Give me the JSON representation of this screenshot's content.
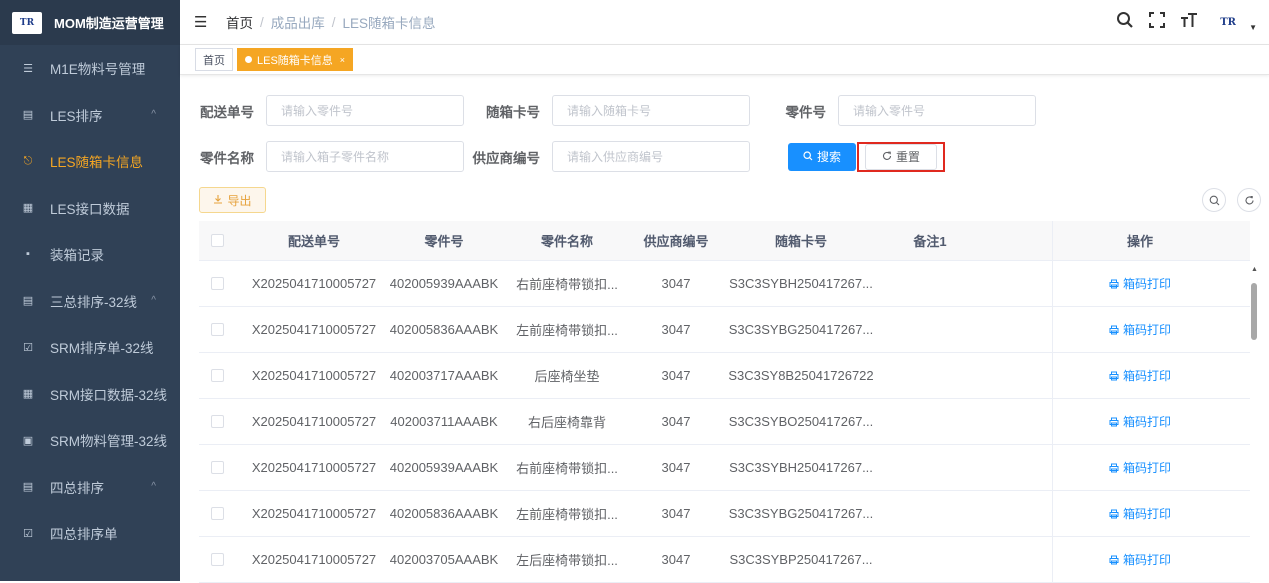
{
  "app": {
    "logo_text": "TR",
    "title": "MOM制造运营管理"
  },
  "sidebar": {
    "items": [
      {
        "label": "M1E物料号管理",
        "icon": "☰",
        "caret": ""
      },
      {
        "label": "LES排序",
        "icon": "▤",
        "caret": "^"
      },
      {
        "label": "LES随箱卡信息",
        "icon": "⎋",
        "caret": ""
      },
      {
        "label": "LES接口数据",
        "icon": "▦",
        "caret": ""
      },
      {
        "label": "装箱记录",
        "icon": "▪",
        "caret": ""
      },
      {
        "label": "三总排序-32线",
        "icon": "▤",
        "caret": "^"
      },
      {
        "label": "SRM排序单-32线",
        "icon": "☑",
        "caret": ""
      },
      {
        "label": "SRM接口数据-32线",
        "icon": "▦",
        "caret": ""
      },
      {
        "label": "SRM物料管理-32线",
        "icon": "▣",
        "caret": ""
      },
      {
        "label": "四总排序",
        "icon": "▤",
        "caret": "^"
      },
      {
        "label": "四总排序单",
        "icon": "☑",
        "caret": ""
      }
    ],
    "active_index": 2
  },
  "breadcrumb": {
    "home": "首页",
    "sep": "/",
    "level1": "成品出库",
    "level2": "LES随箱卡信息"
  },
  "topbar": {
    "search_icon": "⌕",
    "fullscreen_icon": "⛶",
    "size_icon": "тT",
    "avatar": "TR"
  },
  "tags": {
    "home": "首页",
    "active": "LES随箱卡信息",
    "close": "×"
  },
  "form": {
    "delivery_no": {
      "label": "配送单号",
      "placeholder": "请输入零件号"
    },
    "card_no": {
      "label": "随箱卡号",
      "placeholder": "请输入随箱卡号"
    },
    "part_no": {
      "label": "零件号",
      "placeholder": "请输入零件号"
    },
    "part_name": {
      "label": "零件名称",
      "placeholder": "请输入箱子零件名称"
    },
    "supplier_no": {
      "label": "供应商编号",
      "placeholder": "请输入供应商编号"
    },
    "search_label": "搜索",
    "reset_label": "重置"
  },
  "toolbar": {
    "export_label": "导出"
  },
  "table": {
    "columns": [
      "配送单号",
      "零件号",
      "零件名称",
      "供应商编号",
      "随箱卡号",
      "备注1",
      "操作"
    ],
    "op_label": "箱码打印",
    "rows": [
      {
        "no": "X2025041710005727",
        "part": "402005939AAABK",
        "name": "右前座椅带锁扣...",
        "sup": "3047",
        "card": "S3C3SYBH250417267...",
        "note": ""
      },
      {
        "no": "X2025041710005727",
        "part": "402005836AAABK",
        "name": "左前座椅带锁扣...",
        "sup": "3047",
        "card": "S3C3SYBG250417267...",
        "note": ""
      },
      {
        "no": "X2025041710005727",
        "part": "402003717AAABK",
        "name": "后座椅坐垫",
        "sup": "3047",
        "card": "S3C3SY8B25041726722",
        "note": ""
      },
      {
        "no": "X2025041710005727",
        "part": "402003711AAABK",
        "name": "右后座椅靠背",
        "sup": "3047",
        "card": "S3C3SYBO250417267...",
        "note": ""
      },
      {
        "no": "X2025041710005727",
        "part": "402005939AAABK",
        "name": "右前座椅带锁扣...",
        "sup": "3047",
        "card": "S3C3SYBH250417267...",
        "note": ""
      },
      {
        "no": "X2025041710005727",
        "part": "402005836AAABK",
        "name": "左前座椅带锁扣...",
        "sup": "3047",
        "card": "S3C3SYBG250417267...",
        "note": ""
      },
      {
        "no": "X2025041710005727",
        "part": "402003705AAABK",
        "name": "左后座椅带锁扣...",
        "sup": "3047",
        "card": "S3C3SYBP250417267...",
        "note": ""
      }
    ]
  },
  "colors": {
    "sidebar_bg": "#304156",
    "accent_orange": "#f5a623",
    "primary_blue": "#1890ff",
    "highlight_red": "#e0291f"
  }
}
